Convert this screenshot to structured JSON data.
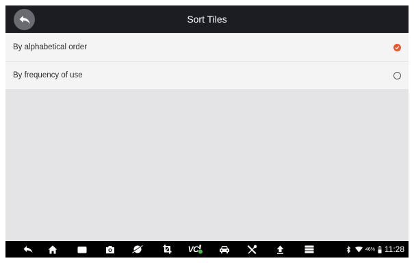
{
  "header": {
    "title": "Sort Tiles",
    "back_icon": "back-arrow-icon"
  },
  "options": [
    {
      "label": "By alphabetical order",
      "selected": true
    },
    {
      "label": "By frequency of use",
      "selected": false
    }
  ],
  "colors": {
    "header_bg": "#1c1d22",
    "accent": "#e8562b",
    "content_bg": "#e4e4e6",
    "vci_status": "#3fbf3f"
  },
  "navbar": {
    "icons": [
      "back-icon",
      "home-icon",
      "recent-apps-icon",
      "camera-icon",
      "browser-icon",
      "crop-icon",
      "vci-icon",
      "car-icon",
      "tools-icon",
      "upload-icon",
      "menu-icon"
    ],
    "vci_label": "VC",
    "status": {
      "icons": [
        "bluetooth-icon",
        "wifi-icon",
        "battery-icon"
      ],
      "battery": "46%",
      "time": "11:28"
    }
  }
}
